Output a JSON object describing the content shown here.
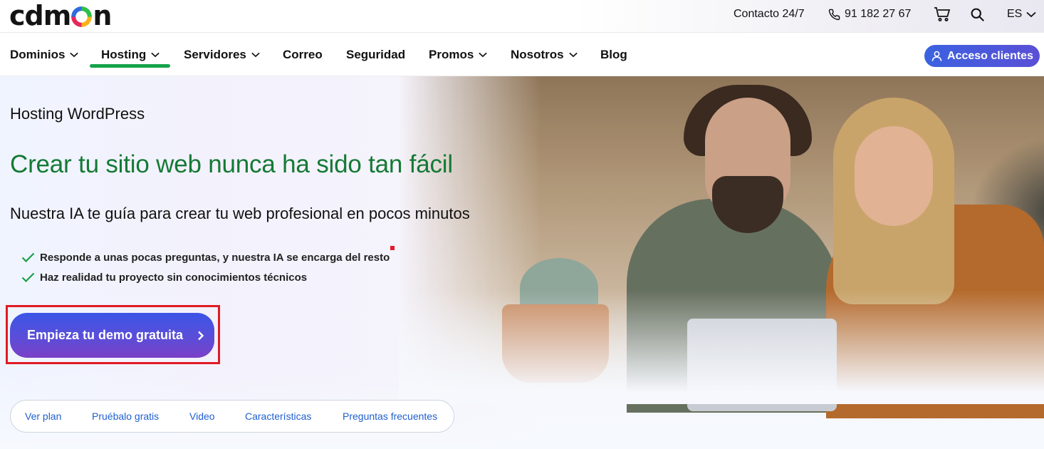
{
  "brand": {
    "logo_pre": "cd",
    "logo_post": "m",
    "logo_end": "n",
    "colors": {
      "green": "#2dc04a",
      "yellow": "#f7b21b",
      "pink": "#e6275a",
      "blue": "#2f6bde"
    }
  },
  "topbar": {
    "contact": "Contacto 24/7",
    "phone": "91 182 27 67",
    "language": "ES"
  },
  "nav": {
    "items": [
      {
        "label": "Dominios"
      },
      {
        "label": "Hosting"
      },
      {
        "label": "Servidores"
      },
      {
        "label": "Correo"
      },
      {
        "label": "Seguridad"
      },
      {
        "label": "Promos"
      },
      {
        "label": "Nosotros"
      },
      {
        "label": "Blog"
      }
    ],
    "active": "Hosting",
    "access_button": "Acceso clientes"
  },
  "hero": {
    "eyebrow": "Hosting WordPress",
    "title": "Crear tu sitio web nunca ha sido tan fácil",
    "subtitle": "Nuestra IA te guía para crear tu web profesional en pocos minutos",
    "bullets": [
      "Responde a unas pocas preguntas, y nuestra IA se encarga del resto",
      "Haz realidad tu proyecto sin conocimientos técnicos"
    ],
    "cta": "Empieza tu demo gratuita",
    "accent_green": "#147a35"
  },
  "subnav": {
    "items": [
      "Ver plan",
      "Pruébalo gratis",
      "Video",
      "Características",
      "Preguntas frecuentes"
    ]
  }
}
